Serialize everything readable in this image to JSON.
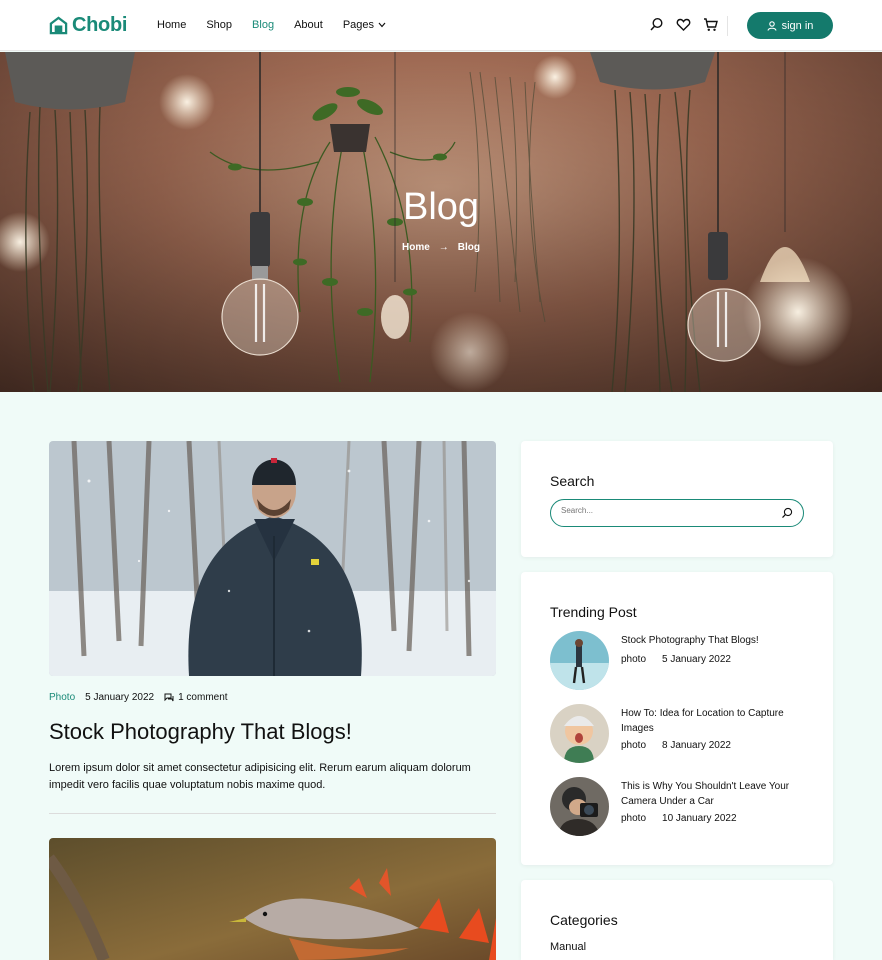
{
  "header": {
    "logo": "Chobi",
    "nav": [
      "Home",
      "Shop",
      "Blog",
      "About",
      "Pages"
    ],
    "signin": "sign in",
    "colors": {
      "brand": "#1a8a78",
      "button": "#147a6c"
    }
  },
  "hero": {
    "title": "Blog",
    "breadcrumb_home": "Home",
    "breadcrumb_arrow": "→",
    "breadcrumb_current": "Blog"
  },
  "post": {
    "category": "Photo",
    "date": "5 January 2022",
    "comments": "1 comment",
    "title": "Stock Photography That Blogs!",
    "excerpt": "Lorem ipsum dolor sit amet consectetur adipisicing elit. Rerum earum aliquam dolorum impedit vero facilis quae voluptatum nobis maxime quod."
  },
  "sidebar": {
    "search_title": "Search",
    "search_placeholder": "Search...",
    "trending_title": "Trending Post",
    "trending": [
      {
        "title": "Stock Photography That Blogs!",
        "cat": "photo",
        "date": "5 January 2022"
      },
      {
        "title": "How To: Idea for Location to Capture Images",
        "cat": "photo",
        "date": "8 January 2022"
      },
      {
        "title": "This is Why You Shouldn't Leave Your Camera Under a Car",
        "cat": "photo",
        "date": "10 January 2022"
      }
    ],
    "categories_title": "Categories",
    "categories": [
      "Manual"
    ]
  }
}
